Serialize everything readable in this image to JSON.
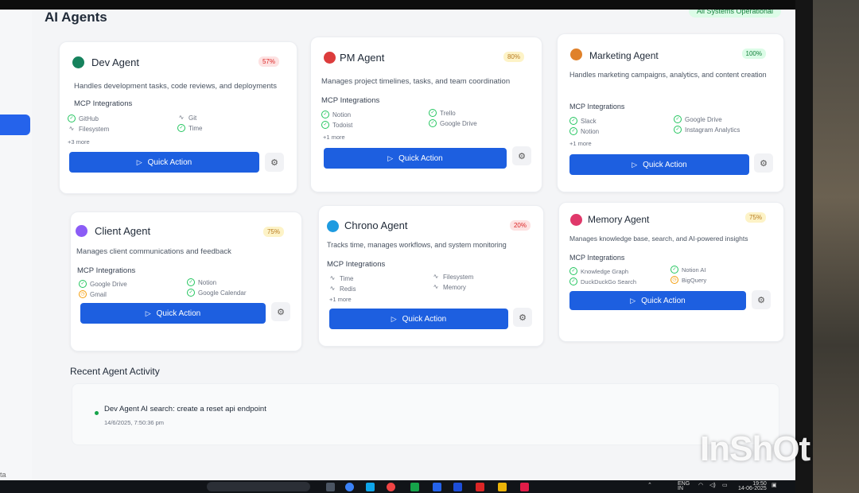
{
  "page": {
    "title": "AI Agents",
    "status": "All Systems Operational"
  },
  "agents": [
    {
      "name": "Dev Agent",
      "badge": "57%",
      "color": "#16825d",
      "badge_bg": "#fde2e2",
      "badge_fg": "#dc2626",
      "description": "Handles development tasks, code reviews, and deployments",
      "mcp_title": "MCP Integrations",
      "integrations": [
        {
          "icon": "check-circle-icon",
          "label": "GitHub"
        },
        {
          "icon": "pulse-icon",
          "label": "Git"
        },
        {
          "icon": "pulse-icon",
          "label": "Filesystem"
        },
        {
          "icon": "check-circle-icon",
          "label": "Time"
        }
      ],
      "more": "+3 more",
      "action": "Quick Action"
    },
    {
      "name": "PM Agent",
      "badge": "80%",
      "color": "#dc3c3c",
      "badge_bg": "#fdf3c7",
      "badge_fg": "#b7791f",
      "description": "Manages project timelines, tasks, and team coordination",
      "mcp_title": "MCP Integrations",
      "integrations": [
        {
          "icon": "check-circle-icon",
          "label": "Notion"
        },
        {
          "icon": "check-circle-icon",
          "label": "Trello"
        },
        {
          "icon": "check-circle-icon",
          "label": "Todoist"
        },
        {
          "icon": "check-circle-icon",
          "label": "Google Drive"
        }
      ],
      "more": "+1 more",
      "action": "Quick Action"
    },
    {
      "name": "Marketing Agent",
      "badge": "100%",
      "color": "#e0812a",
      "badge_bg": "#dcfce7",
      "badge_fg": "#15803d",
      "description": "Handles marketing campaigns, analytics, and content creation",
      "mcp_title": "MCP Integrations",
      "integrations": [
        {
          "icon": "check-circle-icon",
          "label": "Slack"
        },
        {
          "icon": "check-circle-icon",
          "label": "Google Drive"
        },
        {
          "icon": "check-circle-icon",
          "label": "Notion"
        },
        {
          "icon": "check-circle-icon",
          "label": "Instagram Analytics"
        }
      ],
      "more": "+1 more",
      "action": "Quick Action"
    },
    {
      "name": "Client Agent",
      "badge": "75%",
      "color": "#8b5cf6",
      "badge_bg": "#fdf3c7",
      "badge_fg": "#b7791f",
      "description": "Manages client communications and feedback",
      "mcp_title": "MCP Integrations",
      "integrations": [
        {
          "icon": "check-circle-icon",
          "label": "Google Drive"
        },
        {
          "icon": "check-circle-icon",
          "label": "Notion"
        },
        {
          "icon": "clock-icon",
          "label": "Gmail"
        },
        {
          "icon": "check-circle-icon",
          "label": "Google Calendar"
        }
      ],
      "more": "",
      "action": "Quick Action"
    },
    {
      "name": "Chrono Agent",
      "badge": "20%",
      "color": "#1e9be0",
      "badge_bg": "#fde2e2",
      "badge_fg": "#dc2626",
      "description": "Tracks time, manages workflows, and system monitoring",
      "mcp_title": "MCP Integrations",
      "integrations": [
        {
          "icon": "pulse-icon",
          "label": "Time"
        },
        {
          "icon": "pulse-icon",
          "label": "Filesystem"
        },
        {
          "icon": "pulse-icon",
          "label": "Redis"
        },
        {
          "icon": "pulse-icon",
          "label": "Memory"
        }
      ],
      "more": "+1 more",
      "action": "Quick Action"
    },
    {
      "name": "Memory Agent",
      "badge": "75%",
      "color": "#e0386a",
      "badge_bg": "#fdf3c7",
      "badge_fg": "#b7791f",
      "description": "Manages knowledge base, search, and AI-powered insights",
      "mcp_title": "MCP Integrations",
      "integrations": [
        {
          "icon": "check-circle-icon",
          "label": "Knowledge Graph"
        },
        {
          "icon": "check-circle-icon",
          "label": "Notion AI"
        },
        {
          "icon": "check-circle-icon",
          "label": "DuckDuckGo Search"
        },
        {
          "icon": "clock-icon",
          "label": "BigQuery"
        }
      ],
      "more": "",
      "action": "Quick Action"
    }
  ],
  "activity": {
    "title": "Recent Agent Activity",
    "items": [
      {
        "text": "Dev Agent AI search: create a reset api endpoint",
        "time": "14/6/2025, 7:50:36 pm"
      }
    ]
  },
  "sidebar": {
    "footer_text": "ta"
  },
  "taskbar": {
    "lang": "ENG",
    "region": "IN",
    "time": "19:50",
    "date": "14-06-2025"
  },
  "watermark": "InShOt"
}
